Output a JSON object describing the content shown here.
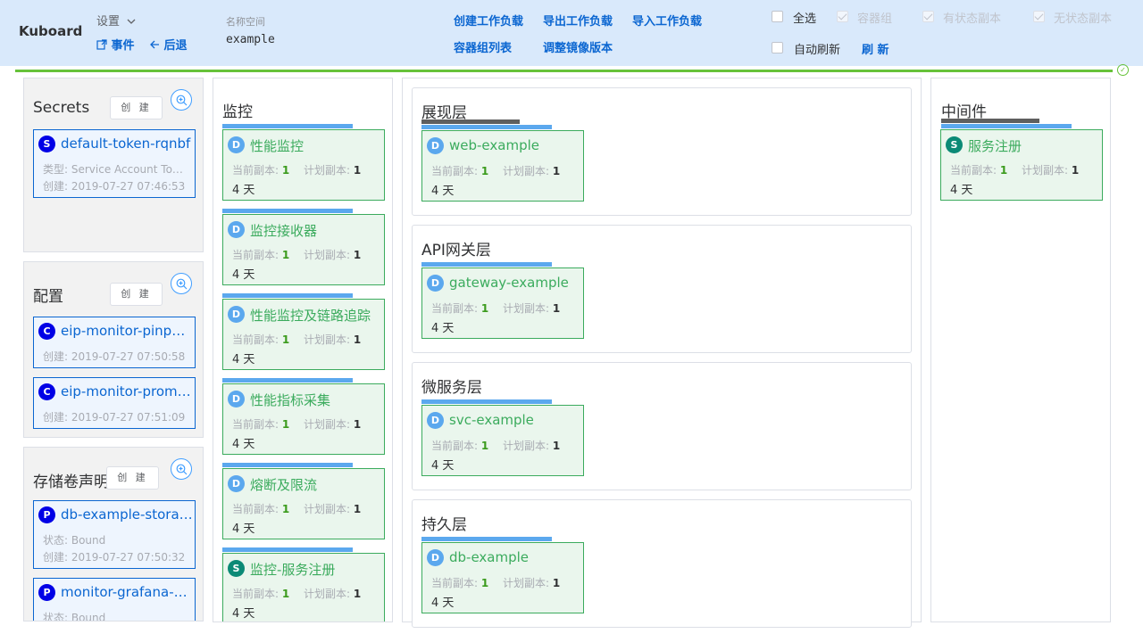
{
  "header": {
    "brand": "Kuboard",
    "settings_label": "设置",
    "events_label": "事件",
    "back_label": "后退",
    "namespace_label": "名称空间",
    "namespace_value": "example",
    "actions": [
      "创建工作负载",
      "导出工作负载",
      "导入工作负载",
      "容器组列表",
      "调整镜像版本"
    ],
    "filters": [
      {
        "label": "全选",
        "checked": false,
        "disabled": false
      },
      {
        "label": "容器组",
        "checked": true,
        "disabled": true
      },
      {
        "label": "有状态副本",
        "checked": true,
        "disabled": true
      },
      {
        "label": "无状态副本",
        "checked": true,
        "disabled": true
      }
    ],
    "auto_refresh_label": "自动刷新",
    "refresh_label": "刷 新"
  },
  "colors": {
    "header_bg": "#d9e9fb",
    "link": "#0b66d1",
    "workload_green": "#3bab5d",
    "progress": "#67c23a",
    "layer_bar": "#5ba8ee"
  },
  "left": {
    "create_label": "创 建",
    "secrets": {
      "title": "Secrets",
      "items": [
        {
          "badge": "S",
          "name": "default-token-rqnbf",
          "meta1": "类型: Service Account Token",
          "meta2": "创建: 2019-07-27 07:46:53"
        }
      ]
    },
    "configs": {
      "title": "配置",
      "items": [
        {
          "badge": "C",
          "name": "eip-monitor-pinpoint-config",
          "meta1": "创建: 2019-07-27 07:50:58"
        },
        {
          "badge": "C",
          "name": "eip-monitor-prometheus-config",
          "meta1": "创建: 2019-07-27 07:51:09"
        }
      ]
    },
    "pvcs": {
      "title": "存储卷声明",
      "items": [
        {
          "badge": "P",
          "name": "db-example-storage",
          "meta1": "状态: Bound",
          "meta2": "创建: 2019-07-27 07:50:32"
        },
        {
          "badge": "P",
          "name": "monitor-grafana-storage",
          "meta1": "状态: Bound"
        }
      ]
    }
  },
  "workload_labels": {
    "current": "当前副本:",
    "planned": "计划副本:"
  },
  "monitor": {
    "title": "监控",
    "items": [
      {
        "badge": "D",
        "name": "性能监控",
        "current": "1",
        "planned": "1",
        "age": "4  天"
      },
      {
        "badge": "D",
        "name": "监控接收器",
        "current": "1",
        "planned": "1",
        "age": "4  天"
      },
      {
        "badge": "D",
        "name": "性能监控及链路追踪",
        "current": "1",
        "planned": "1",
        "age": "4  天"
      },
      {
        "badge": "D",
        "name": "性能指标采集",
        "current": "1",
        "planned": "1",
        "age": "4  天"
      },
      {
        "badge": "D",
        "name": "熔断及限流",
        "current": "1",
        "planned": "1",
        "age": "4  天"
      },
      {
        "badge": "S",
        "name": "监控-服务注册",
        "current": "1",
        "planned": "1",
        "age": "4  天"
      }
    ]
  },
  "layers": [
    {
      "title": "展现层",
      "item": {
        "badge": "D",
        "name": "web-example",
        "current": "1",
        "planned": "1",
        "age": "4  天"
      }
    },
    {
      "title": "API网关层",
      "item": {
        "badge": "D",
        "name": "gateway-example",
        "current": "1",
        "planned": "1",
        "age": "4  天"
      }
    },
    {
      "title": "微服务层",
      "item": {
        "badge": "D",
        "name": "svc-example",
        "current": "1",
        "planned": "1",
        "age": "4  天"
      }
    },
    {
      "title": "持久层",
      "item": {
        "badge": "D",
        "name": "db-example",
        "current": "1",
        "planned": "1",
        "age": "4  天"
      }
    }
  ],
  "middleware": {
    "title": "中间件",
    "item": {
      "badge": "S",
      "name": "服务注册",
      "current": "1",
      "planned": "1",
      "age": "4  天"
    }
  }
}
